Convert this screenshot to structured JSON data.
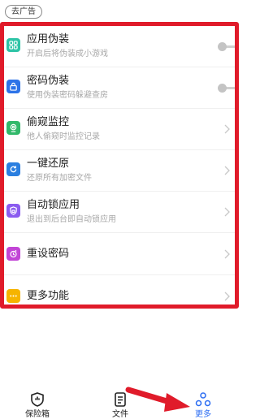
{
  "ad": {
    "label": "去广告"
  },
  "menu": [
    {
      "title": "应用伪装",
      "subtitle": "开启后将伪装成小游戏",
      "icon": "grid-apps-icon",
      "icon_color": "#2ec4a6",
      "control": "toggle"
    },
    {
      "title": "密码伪装",
      "subtitle": "使用伪装密码躲避查房",
      "icon": "lock-icon",
      "icon_color": "#2d73e8",
      "control": "toggle"
    },
    {
      "title": "偷窥监控",
      "subtitle": "他人偷窥时监控记录",
      "icon": "camera-icon",
      "icon_color": "#31b96a",
      "control": "chevron"
    },
    {
      "title": "一键还原",
      "subtitle": "还原所有加密文件",
      "icon": "restore-icon",
      "icon_color": "#2b7fe0",
      "control": "chevron"
    },
    {
      "title": "自动锁应用",
      "subtitle": "退出到后台即自动锁应用",
      "icon": "shield-lock-icon",
      "icon_color": "#8b5cf0",
      "control": "chevron"
    },
    {
      "title": "重设密码",
      "subtitle": "",
      "icon": "reset-key-icon",
      "icon_color": "#c245d6",
      "control": "chevron"
    },
    {
      "title": "更多功能",
      "subtitle": "",
      "icon": "more-dots-icon",
      "icon_color": "#f6b400",
      "control": "chevron"
    }
  ],
  "nav": [
    {
      "label": "保险箱",
      "icon": "vault-icon",
      "active": false
    },
    {
      "label": "文件",
      "icon": "file-icon",
      "active": false
    },
    {
      "label": "更多",
      "icon": "more-nodes-icon",
      "active": true
    }
  ],
  "colors": {
    "highlight_frame": "#e01b2a",
    "active_nav": "#2c6df2",
    "annotation_arrow": "#e01b2a"
  }
}
